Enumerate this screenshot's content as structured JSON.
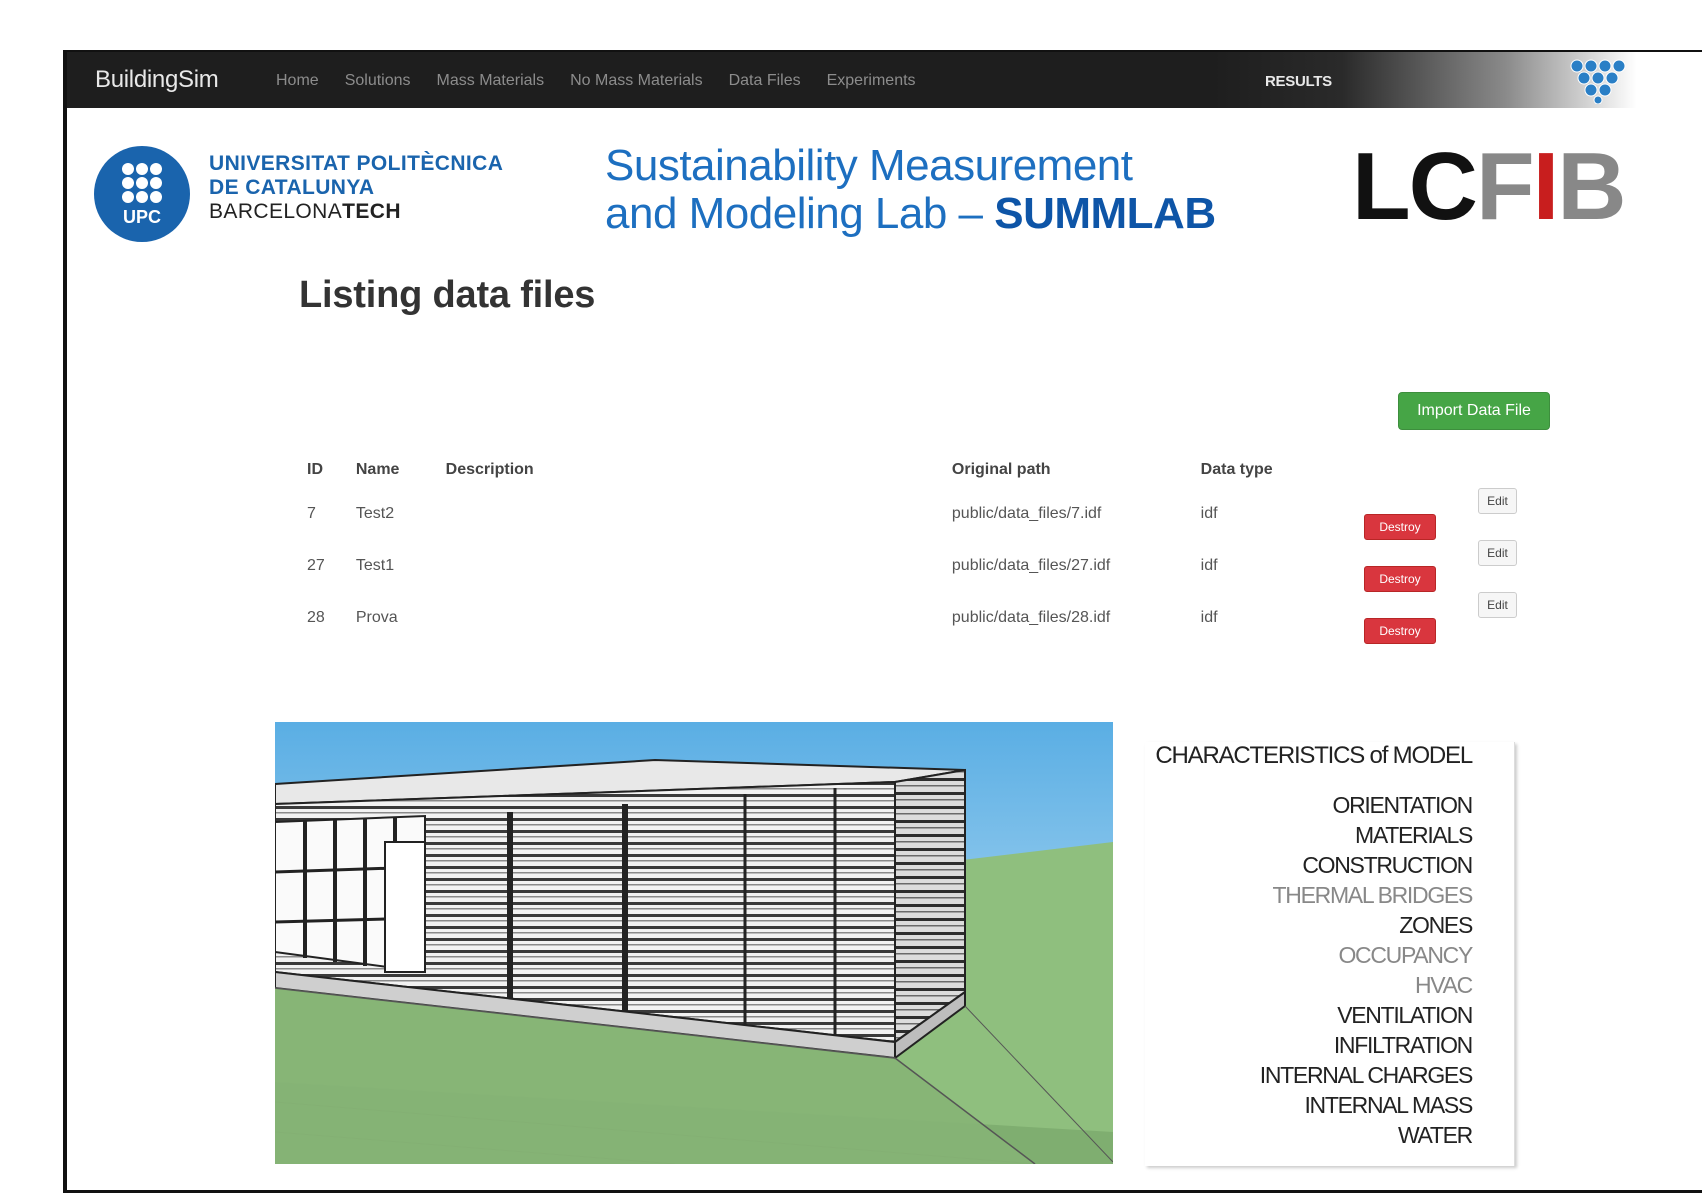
{
  "navbar": {
    "brand": "BuildingSim",
    "links": [
      "Home",
      "Solutions",
      "Mass Materials",
      "No Mass Materials",
      "Data Files",
      "Experiments"
    ],
    "results": "RESULTS"
  },
  "header": {
    "upc": {
      "line1": "UNIVERSITAT POLITÈCNICA",
      "line2": "DE CATALUNYA",
      "line3a": "BARCELONA",
      "line3b": "TECH",
      "logo_text": "UPC"
    },
    "summlab": {
      "line1": "Sustainability Measurement",
      "line2a": "and Modeling Lab – ",
      "line2b": "SUMMLAB"
    },
    "lcfib": {
      "a": "LC",
      "b": "F",
      "c": "I",
      "d": "B"
    }
  },
  "main": {
    "title": "Listing data files",
    "import_button": "Import Data File",
    "table": {
      "headers": {
        "id": "ID",
        "name": "Name",
        "description": "Description",
        "path": "Original path",
        "type": "Data type"
      },
      "rows": [
        {
          "id": "7",
          "name": "Test2",
          "description": "",
          "path": "public/data_files/7.idf",
          "type": "idf"
        },
        {
          "id": "27",
          "name": "Test1",
          "description": "",
          "path": "public/data_files/27.idf",
          "type": "idf"
        },
        {
          "id": "28",
          "name": "Prova",
          "description": "",
          "path": "public/data_files/28.idf",
          "type": "idf"
        }
      ],
      "edit_label": "Edit",
      "destroy_label": "Destroy"
    }
  },
  "characteristics": {
    "title": "CHARACTERISTICS of MODEL",
    "items": [
      {
        "label": "ORIENTATION",
        "muted": false
      },
      {
        "label": "MATERIALS",
        "muted": false
      },
      {
        "label": "CONSTRUCTION",
        "muted": false
      },
      {
        "label": "THERMAL BRIDGES",
        "muted": true
      },
      {
        "label": "ZONES",
        "muted": false
      },
      {
        "label": "OCCUPANCY",
        "muted": true
      },
      {
        "label": "HVAC",
        "muted": true
      },
      {
        "label": "VENTILATION",
        "muted": false
      },
      {
        "label": "INFILTRATION",
        "muted": false
      },
      {
        "label": "INTERNAL CHARGES",
        "muted": false
      },
      {
        "label": "INTERNAL MASS",
        "muted": false
      },
      {
        "label": "WATER",
        "muted": false
      }
    ]
  },
  "colors": {
    "accent": "#1d6fc0",
    "success": "#46a546",
    "danger": "#d9363e",
    "nav": "#1e1e1e"
  }
}
